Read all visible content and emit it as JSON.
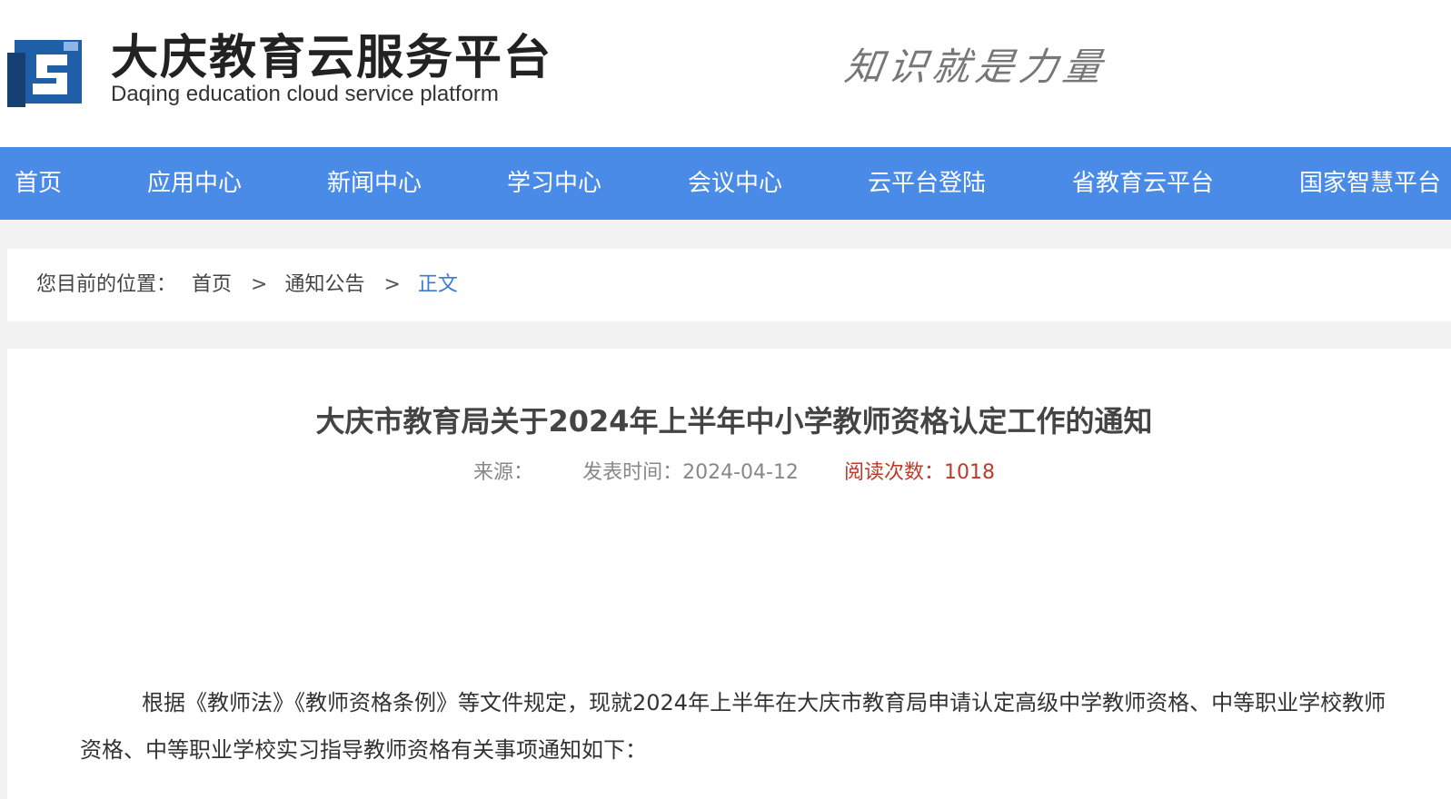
{
  "header": {
    "title_cn": "大庆教育云服务平台",
    "title_en": "Daqing education cloud service platform",
    "slogan": "知识就是力量",
    "logo_icon": "ds-logo-icon",
    "colors": {
      "logo_blue": "#1f5fa8",
      "logo_dark": "#163f73"
    }
  },
  "nav": {
    "background": "#4a8be8",
    "items": [
      {
        "label": "首页"
      },
      {
        "label": "应用中心"
      },
      {
        "label": "新闻中心"
      },
      {
        "label": "学习中心"
      },
      {
        "label": "会议中心"
      },
      {
        "label": "云平台登陆"
      },
      {
        "label": "省教育云平台"
      },
      {
        "label": "国家智慧平台"
      }
    ]
  },
  "breadcrumb": {
    "prefix": "您目前的位置：",
    "home": "首页",
    "separator": ">",
    "section": "通知公告",
    "current": "正文",
    "current_color": "#3a7bd5"
  },
  "article": {
    "title": "大庆市教育局关于2024年上半年中小学教师资格认定工作的通知",
    "source_label": "来源：",
    "source_value": "",
    "time_label": "发表时间：",
    "time_value": "2024-04-12",
    "reads_label": "阅读次数：",
    "reads_value": "1018",
    "reads_color": "#c0392b",
    "paragraph": "根据《教师法》《教师资格条例》等文件规定，现就2024年上半年在大庆市教育局申请认定高级中学教师资格、中等职业学校教师资格、中等职业学校实习指导教师资格有关事项通知如下："
  }
}
